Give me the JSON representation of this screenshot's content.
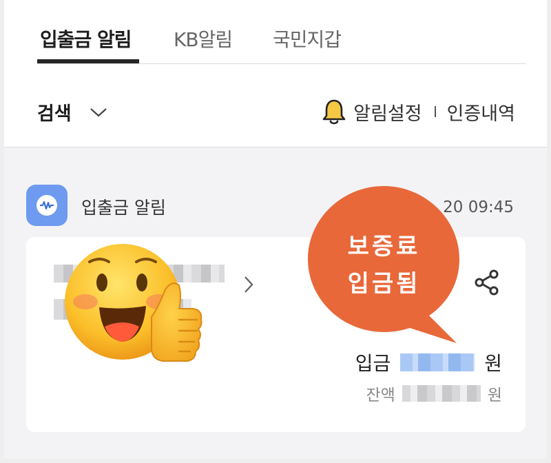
{
  "tabs": [
    {
      "label": "입출금 알림",
      "active": true
    },
    {
      "label": "KB알림",
      "active": false
    },
    {
      "label": "국민지갑",
      "active": false
    }
  ],
  "toolbar": {
    "search_label": "검색",
    "alert_settings_label": "알림설정",
    "auth_history_label": "인증내역"
  },
  "notification": {
    "app_name": "입출금 알림",
    "timestamp": "20 09:45",
    "deposit_label": "입금",
    "deposit_unit": "원",
    "balance_label": "잔액",
    "balance_unit": "원"
  },
  "overlay": {
    "bubble_line1": "보증료",
    "bubble_line2": "입금됨"
  },
  "colors": {
    "accent_bubble": "#e8683a",
    "app_icon": "#6e9af0",
    "tab_active": "#262626"
  }
}
